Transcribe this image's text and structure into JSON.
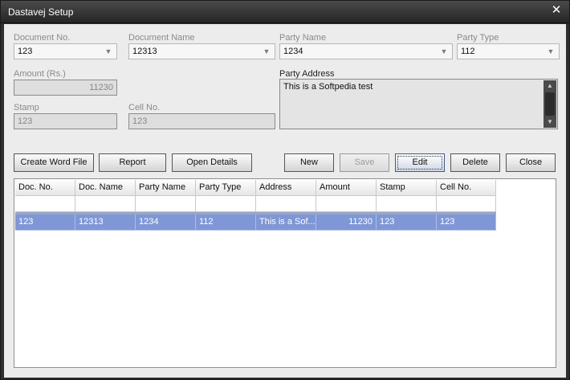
{
  "window": {
    "title": "Dastavej Setup",
    "close_glyph": "✕"
  },
  "form": {
    "document_no": {
      "label": "Document No.",
      "value": "123"
    },
    "document_name": {
      "label": "Document Name",
      "value": "12313"
    },
    "party_name": {
      "label": "Party Name",
      "value": "1234"
    },
    "party_type": {
      "label": "Party Type",
      "value": "112"
    },
    "amount": {
      "label": "Amount (Rs.)",
      "value": "11230"
    },
    "party_address": {
      "label": "Party Address",
      "value": "This is a Softpedia test"
    },
    "stamp": {
      "label": "Stamp",
      "value": "123"
    },
    "cell_no": {
      "label": "Cell No.",
      "value": "123"
    }
  },
  "buttons": {
    "create_word_file": "Create Word File",
    "report": "Report",
    "open_details": "Open Details",
    "new": "New",
    "save": "Save",
    "edit": "Edit",
    "delete": "Delete",
    "close": "Close"
  },
  "grid": {
    "columns": [
      "Doc. No.",
      "Doc. Name",
      "Party Name",
      "Party Type",
      "Address",
      "Amount",
      "Stamp",
      "Cell No."
    ],
    "rows": [
      [
        "123",
        "12313",
        "1234",
        "112",
        "This is a Sof...",
        "11230",
        "123",
        "123"
      ]
    ]
  },
  "icons": {
    "dropdown_arrow": "chevron-down-icon",
    "scroll_up": "scroll-up-icon",
    "scroll_down": "scroll-down-icon"
  }
}
